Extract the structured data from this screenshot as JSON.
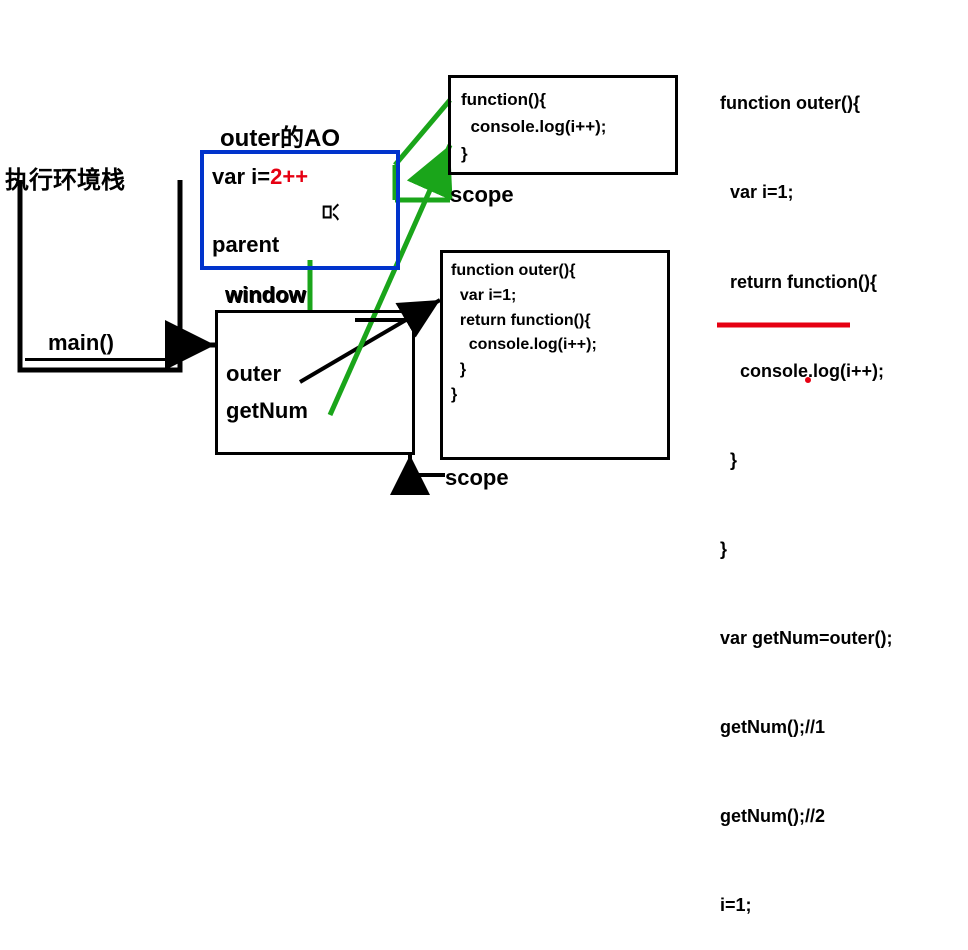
{
  "titles": {
    "execStack": "执行环境栈",
    "outerAO": "outer的AO",
    "scope1": "scope",
    "scope2": "scope"
  },
  "stack": {
    "main": "main()"
  },
  "aoBox": {
    "varLabel": "var  i=",
    "varValue": "2++",
    "parent": "parent",
    "marker": "只"
  },
  "windowBox": {
    "window": "window",
    "outer": "outer",
    "getNum": "getNum"
  },
  "funcBox1": {
    "code": "function(){\n  console.log(i++);\n}"
  },
  "funcBox2": {
    "code": "function outer(){\n  var i=1;\n  return function(){\n    console.log(i++);\n  }\n}"
  },
  "sourceCode": {
    "line1": "function outer(){",
    "line2": "  var i=1;",
    "line3": "  return function(){",
    "line4": "    console.log(i++);",
    "line5": "  }",
    "line6": "}",
    "line7": "var getNum=outer();",
    "line8": "getNum();//1",
    "line9": "getNum();//2",
    "line10": "i=1;"
  }
}
